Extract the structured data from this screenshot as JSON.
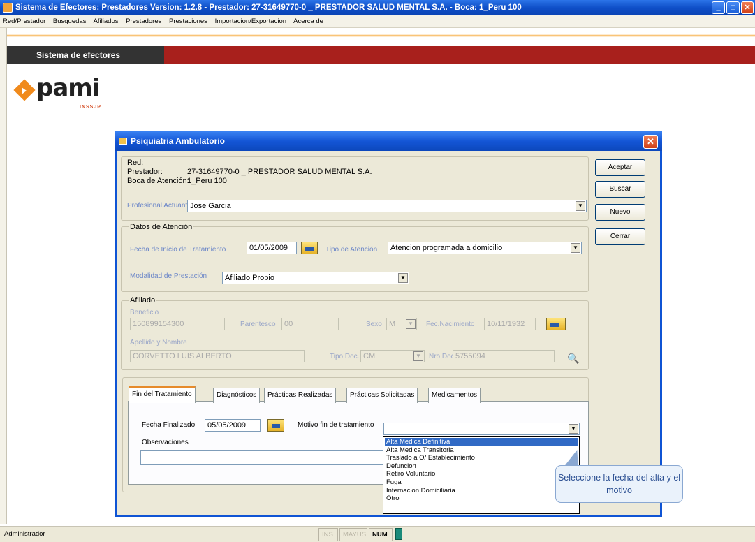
{
  "window": {
    "title": "Sistema de Efectores: Prestadores Version: 1.2.8 - Prestador: 27-31649770-0 _ PRESTADOR SALUD MENTAL S.A. - Boca: 1_Peru 100"
  },
  "menu": [
    "Red/Prestador",
    "Busquedas",
    "Afiliados",
    "Prestadores",
    "Prestaciones",
    "Importacion/Exportacion",
    "Acerca de"
  ],
  "header": {
    "label": "Sistema de efectores"
  },
  "logo": {
    "text": "pami",
    "subtext": "INSSJP"
  },
  "dialog": {
    "title": "Psiquiatria Ambulatorio",
    "red_label": "Red:",
    "prestador_label": "Prestador:",
    "prestador_value": "27-31649770-0 _ PRESTADOR SALUD MENTAL S.A.",
    "boca_label": "Boca de Atención:",
    "boca_value": "1_Peru 100",
    "profesional_label": "Profesional Actuante",
    "profesional_value": "Jose Garcia",
    "datos_group": "Datos de Atención",
    "fecha_inicio_label": "Fecha de Inicio de Tratamiento",
    "fecha_inicio_value": "01/05/2009",
    "tipo_atencion_label": "Tipo de Atención",
    "tipo_atencion_value": "Atencion programada a domicilio",
    "modalidad_label": "Modalidad de Prestación",
    "modalidad_value": "Afiliado Propio",
    "afiliado_group": "Afiliado",
    "beneficio_label": "Beneficio",
    "beneficio_value": "150899154300",
    "parentesco_label": "Parentesco",
    "parentesco_value": "00",
    "sexo_label": "Sexo",
    "sexo_value": "M",
    "fec_nac_label": "Fec.Nacimiento",
    "fec_nac_value": "10/11/1932",
    "apellido_label": "Apellido y Nombre",
    "apellido_value": "CORVETTO LUIS ALBERTO",
    "tipo_doc_label": "Tipo Doc.",
    "tipo_doc_value": "CM",
    "nro_doc_label": "Nro.Doc.",
    "nro_doc_value": "5755094",
    "buttons": {
      "aceptar": "Aceptar",
      "buscar": "Buscar",
      "nuevo": "Nuevo",
      "cerrar": "Cerrar"
    },
    "tabs": [
      "Fin del Tratamiento",
      "Diagnósticos",
      "Prácticas Realizadas",
      "Prácticas Solicitadas",
      "Medicamentos"
    ],
    "fecha_finalizado_label": "Fecha Finalizado",
    "fecha_finalizado_value": "05/05/2009",
    "motivo_label": "Motivo fin de tratamiento",
    "motivo_value": "",
    "observaciones_label": "Observaciones",
    "motivo_options": [
      "Alta Medica Definitiva",
      "Alta Medica Transitoria",
      "Traslado a O/ Establecimiento",
      "Defuncion",
      "Retiro Voluntario",
      "Fuga",
      "Internacion Domiciliaria",
      "Otro"
    ],
    "motivo_highlighted": "Alta Medica Definitiva"
  },
  "tooltip": {
    "text": "Seleccione la fecha del alta y el motivo"
  },
  "statusbar": {
    "user": "Administrador",
    "ins": "INS",
    "mayus": "MAYUS",
    "num": "NUM"
  }
}
